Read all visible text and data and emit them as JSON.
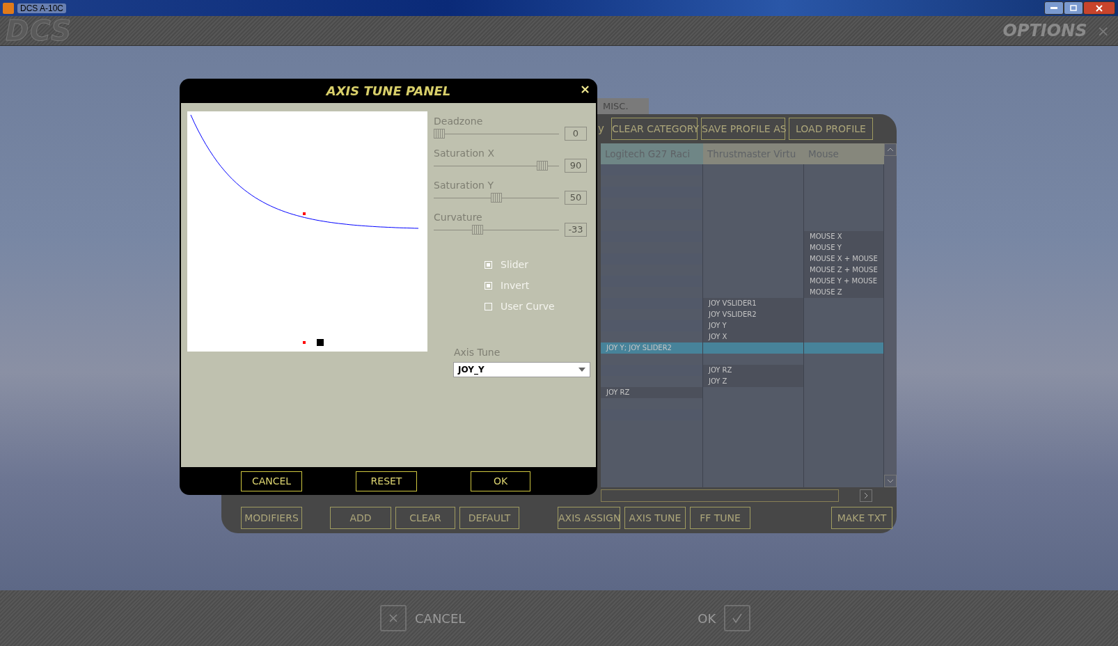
{
  "window": {
    "title": "DCS A-10C"
  },
  "header": {
    "logo": "DCS",
    "title": "OPTIONS",
    "close": "×"
  },
  "tabs": [
    {
      "label": "MISC.",
      "selected": false
    }
  ],
  "toolbar": {
    "partial_label": "y",
    "buttons": [
      "CLEAR CATEGORY",
      "SAVE PROFILE AS",
      "LOAD PROFILE"
    ]
  },
  "table": {
    "columns": [
      "Logitech G27 Raci",
      "Thrustmaster Virtu",
      "Mouse"
    ],
    "rows": [
      {
        "selected": false,
        "cells": [
          null,
          null,
          null
        ]
      },
      {
        "selected": false,
        "cells": [
          null,
          null,
          null
        ]
      },
      {
        "selected": false,
        "cells": [
          null,
          null,
          null
        ]
      },
      {
        "selected": false,
        "cells": [
          null,
          null,
          null
        ]
      },
      {
        "selected": false,
        "cells": [
          null,
          null,
          null
        ]
      },
      {
        "selected": false,
        "cells": [
          null,
          null,
          null
        ]
      },
      {
        "selected": false,
        "cells": [
          null,
          null,
          "MOUSE X"
        ]
      },
      {
        "selected": false,
        "cells": [
          null,
          null,
          "MOUSE Y"
        ]
      },
      {
        "selected": false,
        "cells": [
          null,
          null,
          "MOUSE X + MOUSE"
        ]
      },
      {
        "selected": false,
        "cells": [
          null,
          null,
          "MOUSE Z + MOUSE"
        ]
      },
      {
        "selected": false,
        "cells": [
          null,
          null,
          "MOUSE Y + MOUSE"
        ]
      },
      {
        "selected": false,
        "cells": [
          null,
          null,
          "MOUSE Z"
        ]
      },
      {
        "selected": false,
        "cells": [
          null,
          "JOY VSLIDER1",
          null
        ]
      },
      {
        "selected": false,
        "cells": [
          null,
          "JOY VSLIDER2",
          null
        ]
      },
      {
        "selected": false,
        "cells": [
          null,
          "JOY Y",
          null
        ]
      },
      {
        "selected": false,
        "cells": [
          null,
          "JOY X",
          null
        ]
      },
      {
        "selected": true,
        "cells": [
          "JOY Y; JOY SLIDER2",
          null,
          null
        ]
      },
      {
        "selected": false,
        "cells": [
          null,
          null,
          null
        ]
      },
      {
        "selected": false,
        "cells": [
          null,
          "JOY RZ",
          null
        ]
      },
      {
        "selected": false,
        "cells": [
          null,
          "JOY Z",
          null
        ]
      },
      {
        "selected": false,
        "cells": [
          "JOY RZ",
          null,
          null
        ]
      },
      {
        "selected": false,
        "cells": [
          null,
          null,
          null
        ]
      },
      {
        "selected": false,
        "cells": [
          null,
          null,
          null
        ]
      },
      {
        "selected": false,
        "cells": [
          null,
          null,
          null
        ]
      },
      {
        "selected": false,
        "cells": [
          null,
          null,
          null
        ]
      },
      {
        "selected": false,
        "cells": [
          null,
          null,
          null
        ]
      },
      {
        "selected": false,
        "cells": [
          null,
          null,
          null
        ]
      },
      {
        "selected": false,
        "cells": [
          null,
          null,
          null
        ]
      },
      {
        "selected": false,
        "cells": [
          null,
          null,
          null
        ]
      }
    ]
  },
  "bottom_buttons": [
    "MODIFIERS",
    "ADD",
    "CLEAR",
    "DEFAULT",
    "AXIS ASSIGN",
    "AXIS TUNE",
    "FF TUNE",
    "MAKE TXT"
  ],
  "footer": {
    "cancel": "CANCEL",
    "ok": "OK"
  },
  "dialog": {
    "title": "AXIS TUNE PANEL",
    "close": "×",
    "sliders": [
      {
        "label": "Deadzone",
        "value": "0",
        "level": 0
      },
      {
        "label": "Saturation X",
        "value": "90",
        "level": 0.9
      },
      {
        "label": "Saturation Y",
        "value": "50",
        "level": 0.5
      },
      {
        "label": "Curvature",
        "value": "-33",
        "level": 0.335
      }
    ],
    "options": [
      {
        "label": "Slider",
        "checked": true
      },
      {
        "label": "Invert",
        "checked": true
      },
      {
        "label": "User Curve",
        "checked": false
      }
    ],
    "axis_tune": {
      "label": "Axis Tune",
      "value": "JOY_Y"
    },
    "buttons": [
      "CANCEL",
      "RESET",
      "OK"
    ]
  }
}
